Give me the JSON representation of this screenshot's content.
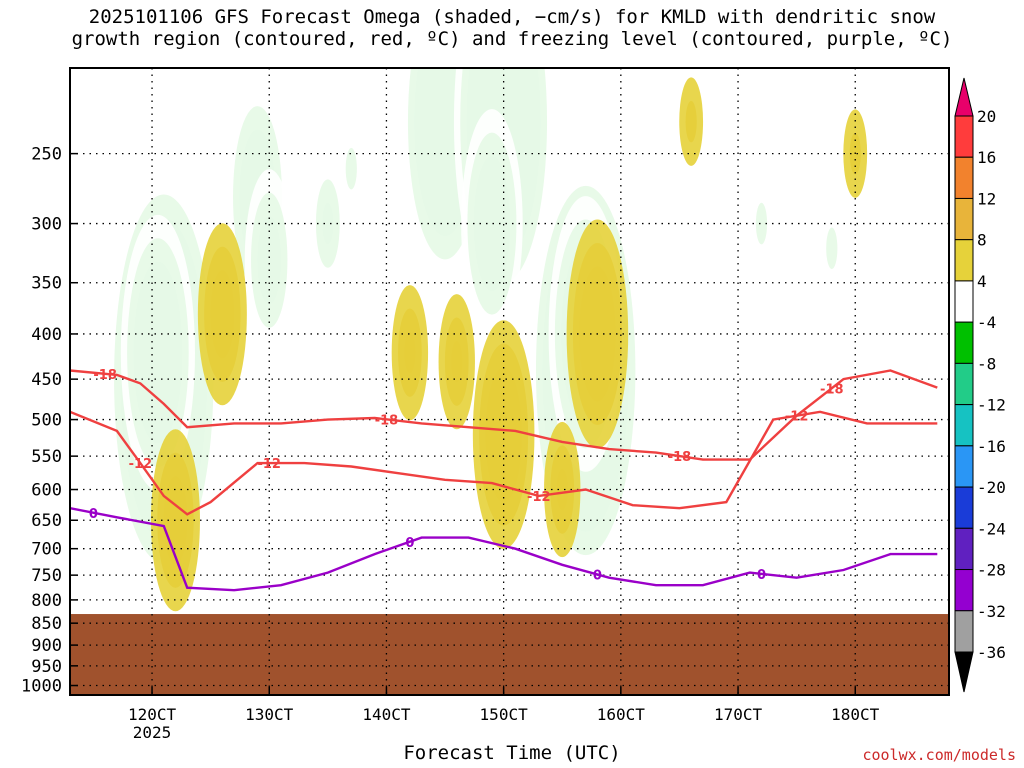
{
  "title": "2025101106 GFS Forecast Omega (shaded, −cm/s) for KMLD with dendritic snow\ngrowth region (contoured, red, ºC) and freezing level (contoured, purple, ºC)",
  "credit": "coolwx.com/models",
  "chart_data": {
    "type": "heatmap",
    "title": "2025101106 GFS Forecast Omega (shaded, −cm/s) for KMLD with dendritic snow growth region (contoured, red, ºC) and freezing level (contoured, purple, ºC)",
    "xlabel": "Forecast Time (UTC)",
    "ylabel": "",
    "x_tick_labels": [
      "120CT",
      "130CT",
      "140CT",
      "150CT",
      "160CT",
      "170CT",
      "180CT"
    ],
    "x_sub_label": "2025",
    "x_range_hours": [
      -7,
      68
    ],
    "y_scale": "log-pressure",
    "y_tick_labels": [
      "250",
      "300",
      "350",
      "400",
      "450",
      "500",
      "550",
      "600",
      "650",
      "700",
      "750",
      "800",
      "850",
      "900",
      "950",
      "1000"
    ],
    "y_range_hPa": [
      200,
      1025
    ],
    "grid": true,
    "colorbar_levels": [
      20,
      16,
      12,
      8,
      4,
      -4,
      -8,
      -12,
      -16,
      -20,
      -24,
      -28,
      -32,
      -36
    ],
    "colorbar_colors": [
      "#e8006a",
      "#ff3c3c",
      "#f2822d",
      "#e8b43a",
      "#e6d23a",
      "#ffffff",
      "#00c000",
      "#22cc88",
      "#16c2c2",
      "#2a96f5",
      "#1a3cd8",
      "#6020c0",
      "#9400d0",
      "#a0a0a0",
      "#000000"
    ],
    "terrain_color": "#a0522d",
    "surface_pressure_hPa": 830,
    "series": [
      {
        "name": "-18",
        "color": "#ef4040",
        "hours": [
          -7,
          -3,
          -1,
          1,
          3,
          7,
          11,
          15,
          19,
          23,
          27,
          31,
          35,
          39,
          43,
          47,
          51,
          55,
          59,
          63,
          67
        ],
        "values_hPa": [
          440,
          445,
          455,
          480,
          510,
          505,
          505,
          500,
          498,
          505,
          510,
          515,
          530,
          540,
          545,
          555,
          555,
          495,
          450,
          440,
          460
        ]
      },
      {
        "name": "-12",
        "color": "#ef4040",
        "hours": [
          -7,
          -3,
          -1,
          1,
          3,
          5,
          9,
          13,
          17,
          21,
          25,
          29,
          33,
          37,
          41,
          45,
          49,
          53,
          57,
          61,
          67
        ],
        "values_hPa": [
          490,
          515,
          560,
          610,
          640,
          620,
          560,
          560,
          565,
          575,
          585,
          590,
          610,
          600,
          625,
          630,
          620,
          500,
          490,
          505,
          505
        ]
      },
      {
        "name": "0",
        "color": "#9a00c8",
        "hours": [
          -7,
          -3,
          1,
          3,
          7,
          11,
          15,
          19,
          23,
          27,
          31,
          35,
          39,
          43,
          47,
          51,
          55,
          59,
          63,
          67
        ],
        "values_hPa": [
          630,
          645,
          660,
          775,
          780,
          770,
          745,
          710,
          680,
          680,
          700,
          730,
          755,
          770,
          770,
          745,
          755,
          740,
          710,
          710
        ]
      }
    ],
    "contour_labels": [
      "-18",
      "-18",
      "-18",
      "-18",
      "-12",
      "-12",
      "-12",
      "-12",
      "0",
      "0",
      "0",
      "0"
    ],
    "omega_blobs": [
      {
        "x": 1,
        "p": 450,
        "v": -36
      },
      {
        "x": 0.5,
        "p": 420,
        "v": -24
      },
      {
        "x": 9,
        "p": 280,
        "v": -20
      },
      {
        "x": 10,
        "p": 330,
        "v": -16
      },
      {
        "x": 15,
        "p": 300,
        "v": -12
      },
      {
        "x": 17,
        "p": 260,
        "v": -8
      },
      {
        "x": 25,
        "p": 230,
        "v": -28
      },
      {
        "x": 30,
        "p": 230,
        "v": -32
      },
      {
        "x": 29,
        "p": 300,
        "v": -20
      },
      {
        "x": 37,
        "p": 440,
        "v": -36
      },
      {
        "x": 37,
        "p": 400,
        "v": -24
      },
      {
        "x": 52,
        "p": 300,
        "v": -8
      },
      {
        "x": 58,
        "p": 320,
        "v": -8
      },
      {
        "x": 2,
        "p": 650,
        "v": 16
      },
      {
        "x": 6,
        "p": 380,
        "v": 16
      },
      {
        "x": 22,
        "p": 420,
        "v": 12
      },
      {
        "x": 26,
        "p": 430,
        "v": 12
      },
      {
        "x": 30,
        "p": 520,
        "v": 20
      },
      {
        "x": 38,
        "p": 400,
        "v": 20
      },
      {
        "x": 35,
        "p": 600,
        "v": 12
      },
      {
        "x": 46,
        "p": 230,
        "v": 8
      },
      {
        "x": 60,
        "p": 250,
        "v": 8
      }
    ]
  }
}
